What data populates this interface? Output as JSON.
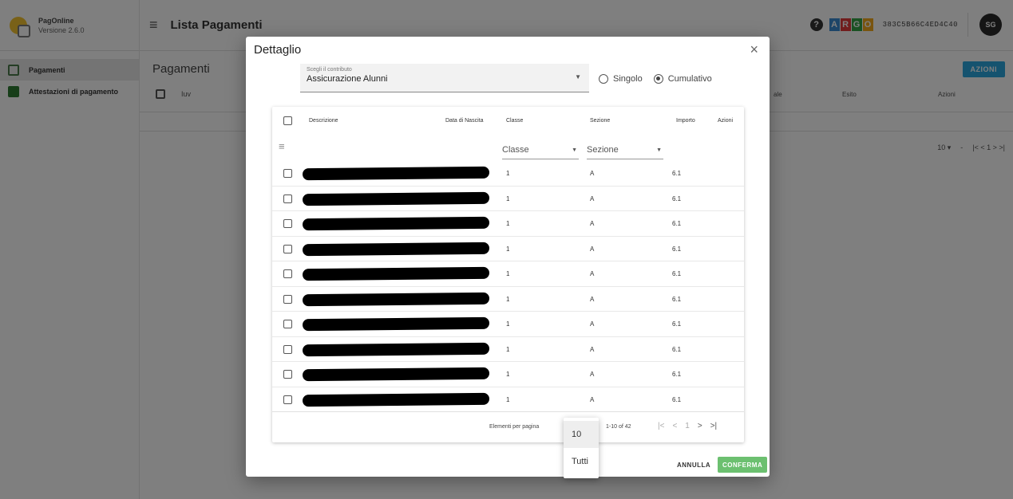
{
  "brand": {
    "name": "PagOnline",
    "version": "Versione 2.6.0"
  },
  "header": {
    "menu_icon": "menu-icon",
    "title": "Lista Pagamenti",
    "argo_letters": [
      "A",
      "R",
      "G",
      "O"
    ],
    "argo_colors": [
      "#3a8bd1",
      "#e23b3b",
      "#35a347",
      "#f2a81d"
    ],
    "code": "383C5B66C4ED4C40",
    "avatar": "SG"
  },
  "sidebar": {
    "items": [
      {
        "label": "Pagamenti",
        "icon": "payment-icon",
        "active": true
      },
      {
        "label": "Attestazioni di pagamento",
        "icon": "certificate-icon",
        "active": false
      }
    ]
  },
  "main": {
    "title": "Pagamenti",
    "first_col": "Iuv",
    "col_partial": "ale",
    "col_esito": "Esito",
    "col_azioni": "Azioni",
    "actions_button": "AZIONI",
    "page_size": "10 ▾",
    "pager_text": "-",
    "pager_nav": "|<  <  1  >  >|"
  },
  "dialog": {
    "title": "Dettaglio",
    "close": "×",
    "select": {
      "label": "Scegli il contributo",
      "value": "Assicurazione Alunni"
    },
    "radio": {
      "singolo": "Singolo",
      "cumulativo": "Cumulativo",
      "selected": "Cumulativo"
    },
    "table": {
      "headers": {
        "descrizione": "Descrizione",
        "data_nascita": "Data di Nascita",
        "classe": "Classe",
        "sezione": "Sezione",
        "importo": "Importo",
        "azioni": "Azioni"
      },
      "filters": {
        "classe": "Classe",
        "sezione": "Sezione"
      },
      "rows": [
        {
          "classe": "1",
          "sezione": "A",
          "importo": "6.1"
        },
        {
          "classe": "1",
          "sezione": "A",
          "importo": "6.1"
        },
        {
          "classe": "1",
          "sezione": "A",
          "importo": "6.1"
        },
        {
          "classe": "1",
          "sezione": "A",
          "importo": "6.1"
        },
        {
          "classe": "1",
          "sezione": "A",
          "importo": "6.1"
        },
        {
          "classe": "1",
          "sezione": "A",
          "importo": "6.1"
        },
        {
          "classe": "1",
          "sezione": "A",
          "importo": "6.1"
        },
        {
          "classe": "1",
          "sezione": "A",
          "importo": "6.1"
        },
        {
          "classe": "1",
          "sezione": "A",
          "importo": "6.1"
        },
        {
          "classe": "1",
          "sezione": "A",
          "importo": "6.1"
        }
      ]
    },
    "pagination": {
      "label": "Elementi per pagina",
      "range": "1-10 of 42",
      "first": "|<",
      "prev": "<",
      "page": "1",
      "next": ">",
      "last": ">|"
    },
    "page_size_options": [
      "10",
      "Tutti"
    ],
    "buttons": {
      "cancel": "ANNULLA",
      "confirm": "CONFERMA"
    }
  }
}
